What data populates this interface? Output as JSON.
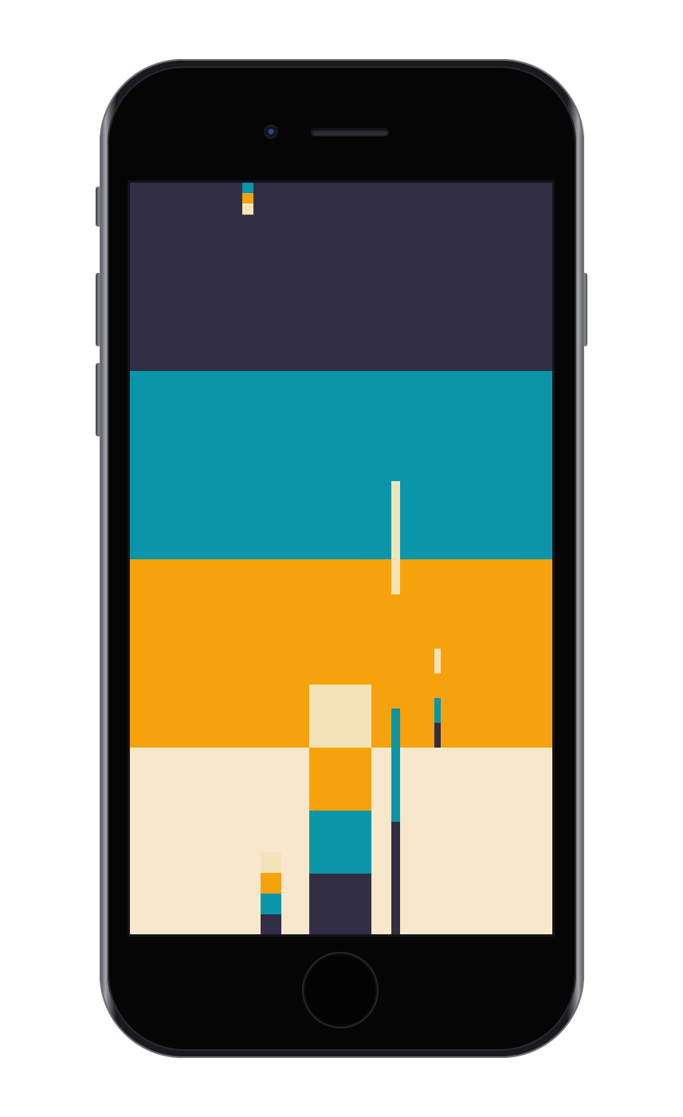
{
  "colors": {
    "navy": "#322e45",
    "teal": "#0a96a8",
    "orange": "#f5a20c",
    "cream": "#f8e8cb",
    "pale": "#f4e3b8"
  },
  "game": {
    "bands": [
      "navy",
      "teal",
      "orange",
      "cream"
    ],
    "pieces": [
      {
        "name": "falling-piece-teal",
        "color": "teal"
      },
      {
        "name": "falling-piece-orange",
        "color": "orange"
      },
      {
        "name": "falling-piece-pale",
        "color": "pale"
      },
      {
        "name": "pale-bar-upper",
        "color": "pale"
      },
      {
        "name": "small-pale-bar",
        "color": "pale"
      },
      {
        "name": "small-teal-bar",
        "color": "teal"
      },
      {
        "name": "small-navy-bar",
        "color": "navy"
      },
      {
        "name": "tall-teal-bar",
        "color": "teal"
      },
      {
        "name": "tall-navy-bar",
        "color": "navy"
      },
      {
        "name": "center-stack-pale",
        "color": "pale"
      },
      {
        "name": "center-stack-orange",
        "color": "orange"
      },
      {
        "name": "center-stack-teal",
        "color": "teal"
      },
      {
        "name": "center-stack-navy",
        "color": "navy"
      },
      {
        "name": "left-stack-pale",
        "color": "pale"
      },
      {
        "name": "left-stack-orange",
        "color": "orange"
      },
      {
        "name": "left-stack-teal",
        "color": "teal"
      },
      {
        "name": "left-stack-navy",
        "color": "navy"
      }
    ]
  }
}
